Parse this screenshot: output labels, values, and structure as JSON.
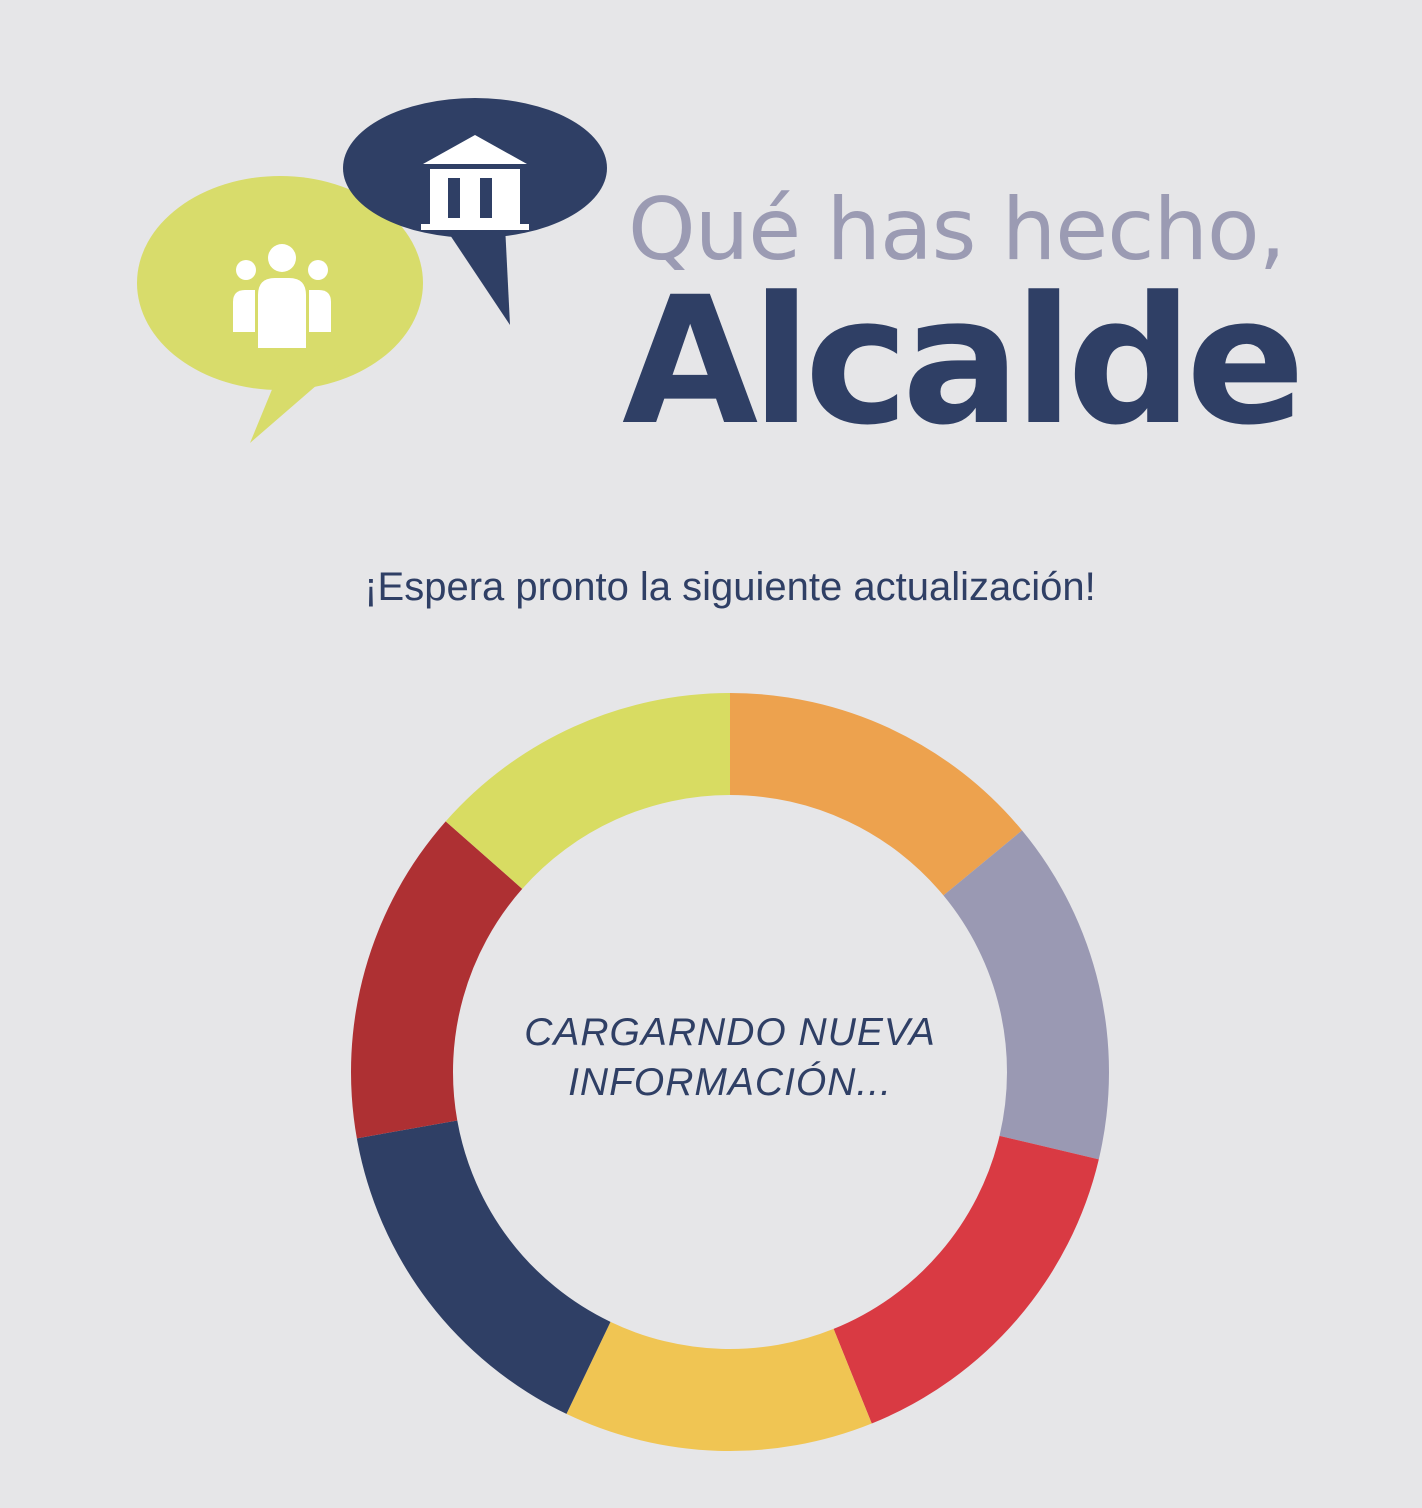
{
  "brand": {
    "line1": "Qué has hecho,",
    "line2": "Alcalde"
  },
  "logo": {
    "green_bubble_icon": "people-icon",
    "blue_bubble_icon": "building-icon",
    "colors": {
      "green": "#d8dc6b",
      "navy": "#2f3f65"
    }
  },
  "tagline": "¡Espera pronto la siguiente actualización!",
  "loader": {
    "line1": "CARGARNDO NUEVA",
    "line2": "INFORMACIÓN...",
    "segments": [
      {
        "color": "#eda24e",
        "fraction": 0.14
      },
      {
        "color": "#9a99b3",
        "fraction": 0.147
      },
      {
        "color": "#d93a43",
        "fraction": 0.152
      },
      {
        "color": "#f0c553",
        "fraction": 0.132
      },
      {
        "color": "#2f3f65",
        "fraction": 0.151
      },
      {
        "color": "#ae3033",
        "fraction": 0.143
      },
      {
        "color": "#d8dc62",
        "fraction": 0.135
      }
    ]
  }
}
